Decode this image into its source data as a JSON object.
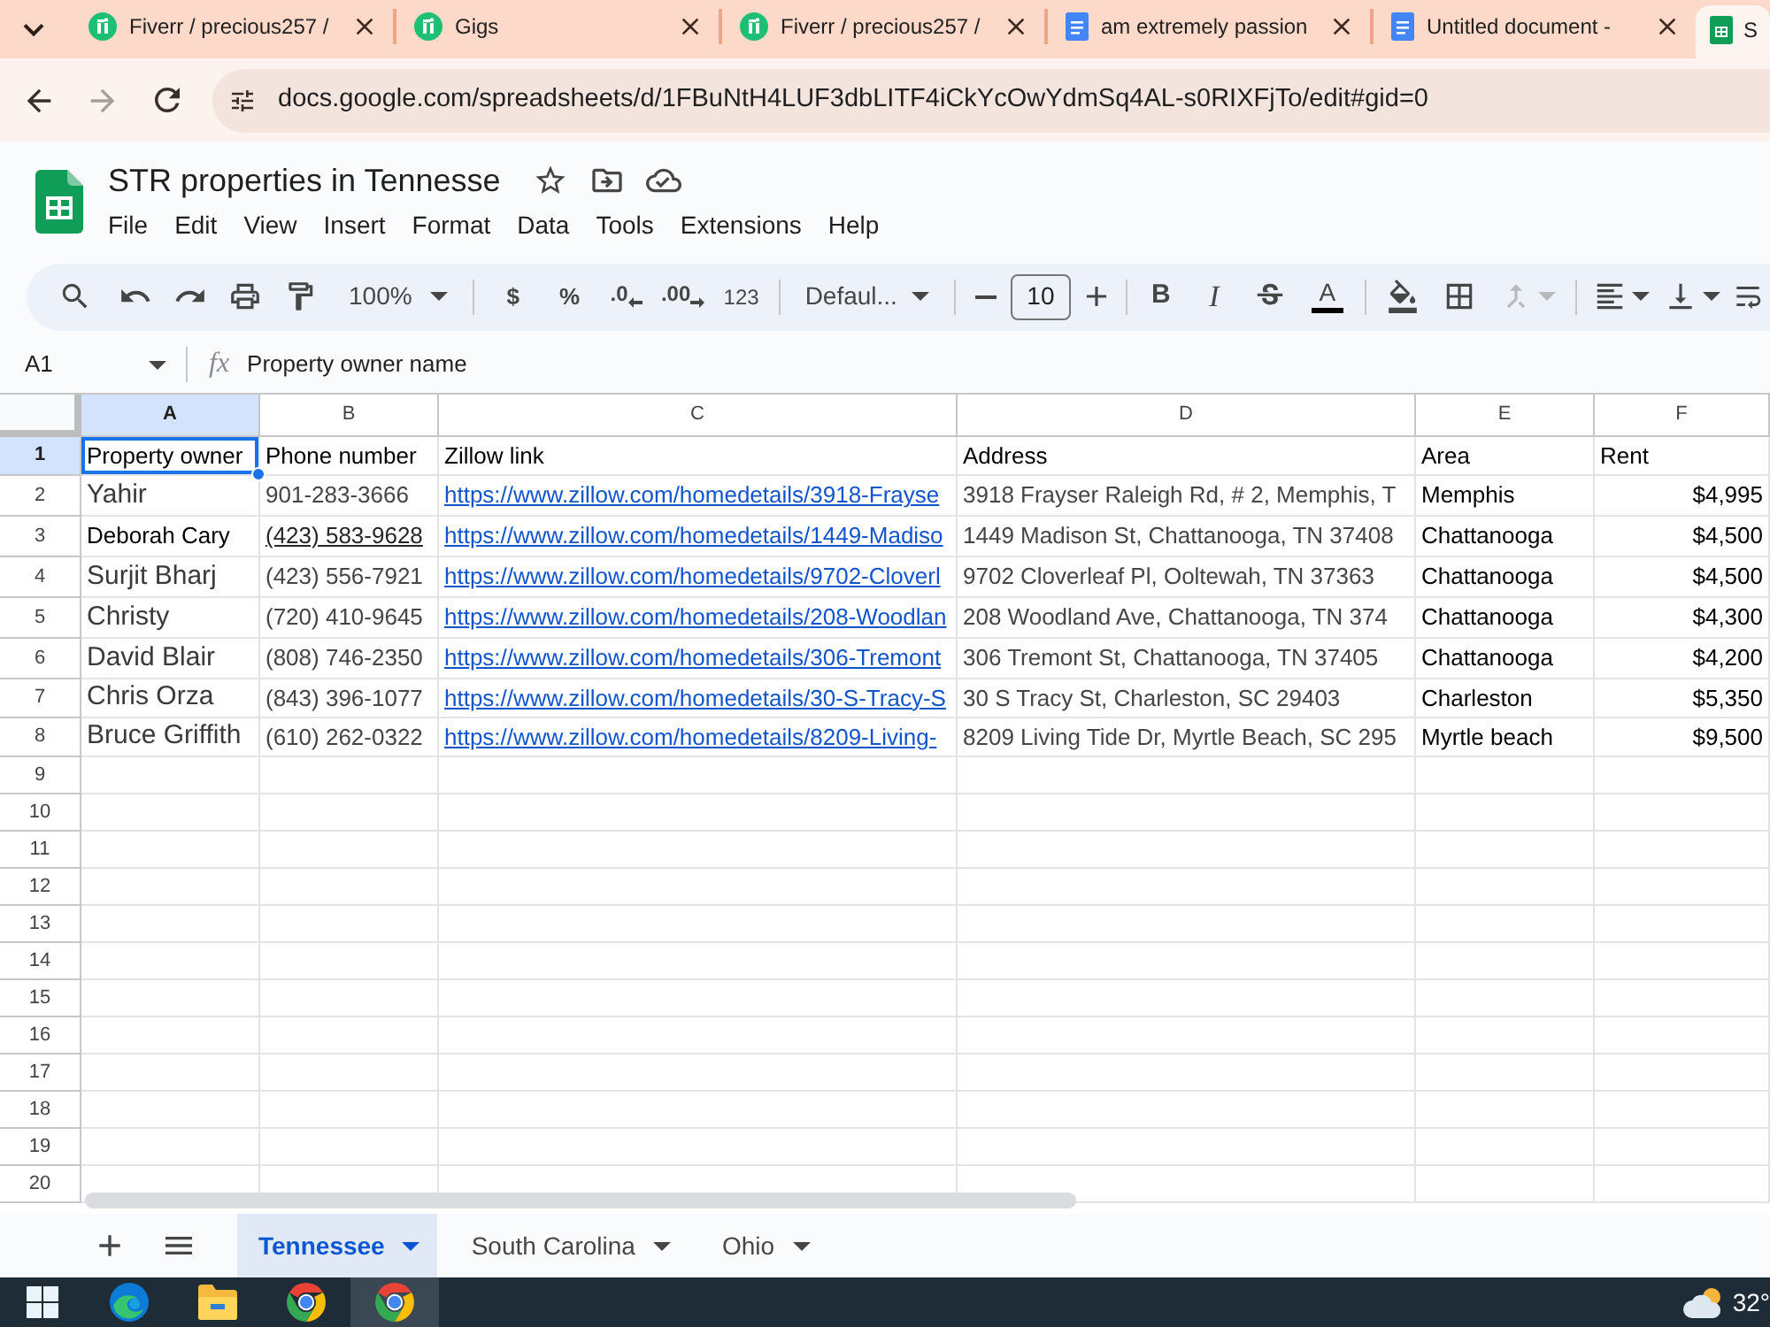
{
  "browser": {
    "tabs": [
      {
        "title": "Fiverr / precious257 /",
        "kind": "fiverr",
        "selected": false
      },
      {
        "title": "Gigs",
        "kind": "fiverr",
        "selected": false
      },
      {
        "title": "Fiverr / precious257 /",
        "kind": "fiverr",
        "selected": false
      },
      {
        "title": "am extremely passion",
        "kind": "docs",
        "selected": false
      },
      {
        "title": "Untitled document -",
        "kind": "docs",
        "selected": false
      },
      {
        "title": "S",
        "kind": "sheets",
        "selected": true
      }
    ],
    "address": "docs.google.com/spreadsheets/d/1FBuNtH4LUF3dbLITF4iCkYcOwYdmSq4AL-s0RIXFjTo/edit#gid=0"
  },
  "document": {
    "title": "STR properties in Tennesse",
    "menu": [
      "File",
      "Edit",
      "View",
      "Insert",
      "Format",
      "Data",
      "Tools",
      "Extensions",
      "Help"
    ]
  },
  "toolbar": {
    "zoom": "100%",
    "currency": "$",
    "percent": "%",
    "decrease_decimal": ".0",
    "increase_decimal": ".00",
    "number_format": "123",
    "font": "Defaul...",
    "font_size": "10",
    "bold": "B",
    "italic": "I",
    "text_color": "A"
  },
  "formula_bar": {
    "cell": "A1",
    "function_label": "fx",
    "formula": "Property owner name"
  },
  "sheet": {
    "columns": [
      {
        "label": "A",
        "selected": true
      },
      {
        "label": "B",
        "selected": false
      },
      {
        "label": "C",
        "selected": false
      },
      {
        "label": "D",
        "selected": false
      },
      {
        "label": "E",
        "selected": false
      },
      {
        "label": "F",
        "selected": false
      }
    ],
    "rows": [
      {
        "number": "1",
        "selected": true,
        "cells": [
          {
            "text": "Property owner",
            "kind": "plain",
            "selected": true
          },
          {
            "text": "Phone number",
            "kind": "plain",
            "selected": false
          },
          {
            "text": "Zillow link",
            "kind": "plain",
            "selected": false
          },
          {
            "text": "Address",
            "kind": "plain",
            "selected": false
          },
          {
            "text": "Area",
            "kind": "plain",
            "selected": false
          },
          {
            "text": "Rent",
            "kind": "plain",
            "selected": false
          }
        ]
      },
      {
        "number": "2",
        "selected": false,
        "cells": [
          {
            "text": "Yahir",
            "kind": "large",
            "selected": false
          },
          {
            "text": "901-283-3666",
            "kind": "grey",
            "selected": false
          },
          {
            "text": "https://www.zillow.com/homedetails/3918-Frayse",
            "kind": "link",
            "selected": false
          },
          {
            "text": "3918 Frayser Raleigh Rd, # 2, Memphis, T",
            "kind": "grey",
            "selected": false
          },
          {
            "text": "Memphis",
            "kind": "plain",
            "selected": false
          },
          {
            "text": "$4,995",
            "kind": "currency",
            "selected": false
          }
        ]
      },
      {
        "number": "3",
        "selected": false,
        "cells": [
          {
            "text": "Deborah Cary",
            "kind": "plain",
            "selected": false
          },
          {
            "text": "(423) 583-9628",
            "kind": "underlined",
            "selected": false
          },
          {
            "text": "https://www.zillow.com/homedetails/1449-Madiso",
            "kind": "link",
            "selected": false
          },
          {
            "text": "1449 Madison St, Chattanooga, TN 37408",
            "kind": "grey",
            "selected": false
          },
          {
            "text": "Chattanooga",
            "kind": "plain",
            "selected": false
          },
          {
            "text": "$4,500",
            "kind": "currency",
            "selected": false
          }
        ]
      },
      {
        "number": "4",
        "selected": false,
        "cells": [
          {
            "text": "Surjit Bharj",
            "kind": "large",
            "selected": false
          },
          {
            "text": "(423) 556-7921",
            "kind": "grey",
            "selected": false
          },
          {
            "text": "https://www.zillow.com/homedetails/9702-Cloverl",
            "kind": "link",
            "selected": false
          },
          {
            "text": "9702 Cloverleaf Pl, Ooltewah, TN 37363",
            "kind": "grey",
            "selected": false
          },
          {
            "text": "Chattanooga",
            "kind": "plain",
            "selected": false
          },
          {
            "text": "$4,500",
            "kind": "currency",
            "selected": false
          }
        ]
      },
      {
        "number": "5",
        "selected": false,
        "cells": [
          {
            "text": "Christy",
            "kind": "large",
            "selected": false
          },
          {
            "text": "(720) 410-9645",
            "kind": "grey",
            "selected": false
          },
          {
            "text": "https://www.zillow.com/homedetails/208-Woodlan",
            "kind": "link",
            "selected": false
          },
          {
            "text": "208 Woodland Ave, Chattanooga, TN 374",
            "kind": "grey",
            "selected": false
          },
          {
            "text": "Chattanooga",
            "kind": "plain",
            "selected": false
          },
          {
            "text": "$4,300",
            "kind": "currency",
            "selected": false
          }
        ]
      },
      {
        "number": "6",
        "selected": false,
        "cells": [
          {
            "text": "David Blair",
            "kind": "large",
            "selected": false
          },
          {
            "text": "(808) 746-2350",
            "kind": "grey",
            "selected": false
          },
          {
            "text": "https://www.zillow.com/homedetails/306-Tremont",
            "kind": "link",
            "selected": false
          },
          {
            "text": "306 Tremont St, Chattanooga, TN 37405",
            "kind": "grey",
            "selected": false
          },
          {
            "text": "Chattanooga",
            "kind": "plain",
            "selected": false
          },
          {
            "text": "$4,200",
            "kind": "currency",
            "selected": false
          }
        ]
      },
      {
        "number": "7",
        "selected": false,
        "cells": [
          {
            "text": "Chris Orza",
            "kind": "large",
            "selected": false
          },
          {
            "text": "(843) 396-1077",
            "kind": "grey",
            "selected": false
          },
          {
            "text": "https://www.zillow.com/homedetails/30-S-Tracy-S",
            "kind": "link",
            "selected": false
          },
          {
            "text": "30 S Tracy St, Charleston, SC 29403",
            "kind": "grey",
            "selected": false
          },
          {
            "text": "Charleston",
            "kind": "plain",
            "selected": false
          },
          {
            "text": "$5,350",
            "kind": "currency",
            "selected": false
          }
        ]
      },
      {
        "number": "8",
        "selected": false,
        "cells": [
          {
            "text": "Bruce Griffith",
            "kind": "large",
            "selected": false
          },
          {
            "text": "(610) 262-0322",
            "kind": "grey",
            "selected": false
          },
          {
            "text": "https://www.zillow.com/homedetails/8209-Living-",
            "kind": "link",
            "selected": false
          },
          {
            "text": "8209 Living Tide Dr, Myrtle Beach, SC 295",
            "kind": "grey",
            "selected": false
          },
          {
            "text": "Myrtle beach",
            "kind": "plain",
            "selected": false
          },
          {
            "text": "$9,500",
            "kind": "currency",
            "selected": false
          }
        ]
      },
      {
        "number": "9",
        "selected": false
      },
      {
        "number": "10",
        "selected": false
      },
      {
        "number": "11",
        "selected": false
      },
      {
        "number": "12",
        "selected": false
      },
      {
        "number": "13",
        "selected": false
      },
      {
        "number": "14",
        "selected": false
      },
      {
        "number": "15",
        "selected": false
      },
      {
        "number": "16",
        "selected": false
      },
      {
        "number": "17",
        "selected": false
      },
      {
        "number": "18",
        "selected": false
      },
      {
        "number": "19",
        "selected": false
      },
      {
        "number": "20",
        "selected": false
      }
    ]
  },
  "sheet_tabs": [
    {
      "name": "Tennessee",
      "selected": true
    },
    {
      "name": "South Carolina",
      "selected": false
    },
    {
      "name": "Ohio",
      "selected": false
    }
  ],
  "taskbar": {
    "apps": [
      {
        "kind": "start",
        "selected": false
      },
      {
        "kind": "edge",
        "selected": false
      },
      {
        "kind": "explorer",
        "selected": false
      },
      {
        "kind": "chrome",
        "selected": false
      },
      {
        "kind": "chrome-profile",
        "selected": true
      }
    ],
    "temperature": "32°"
  }
}
